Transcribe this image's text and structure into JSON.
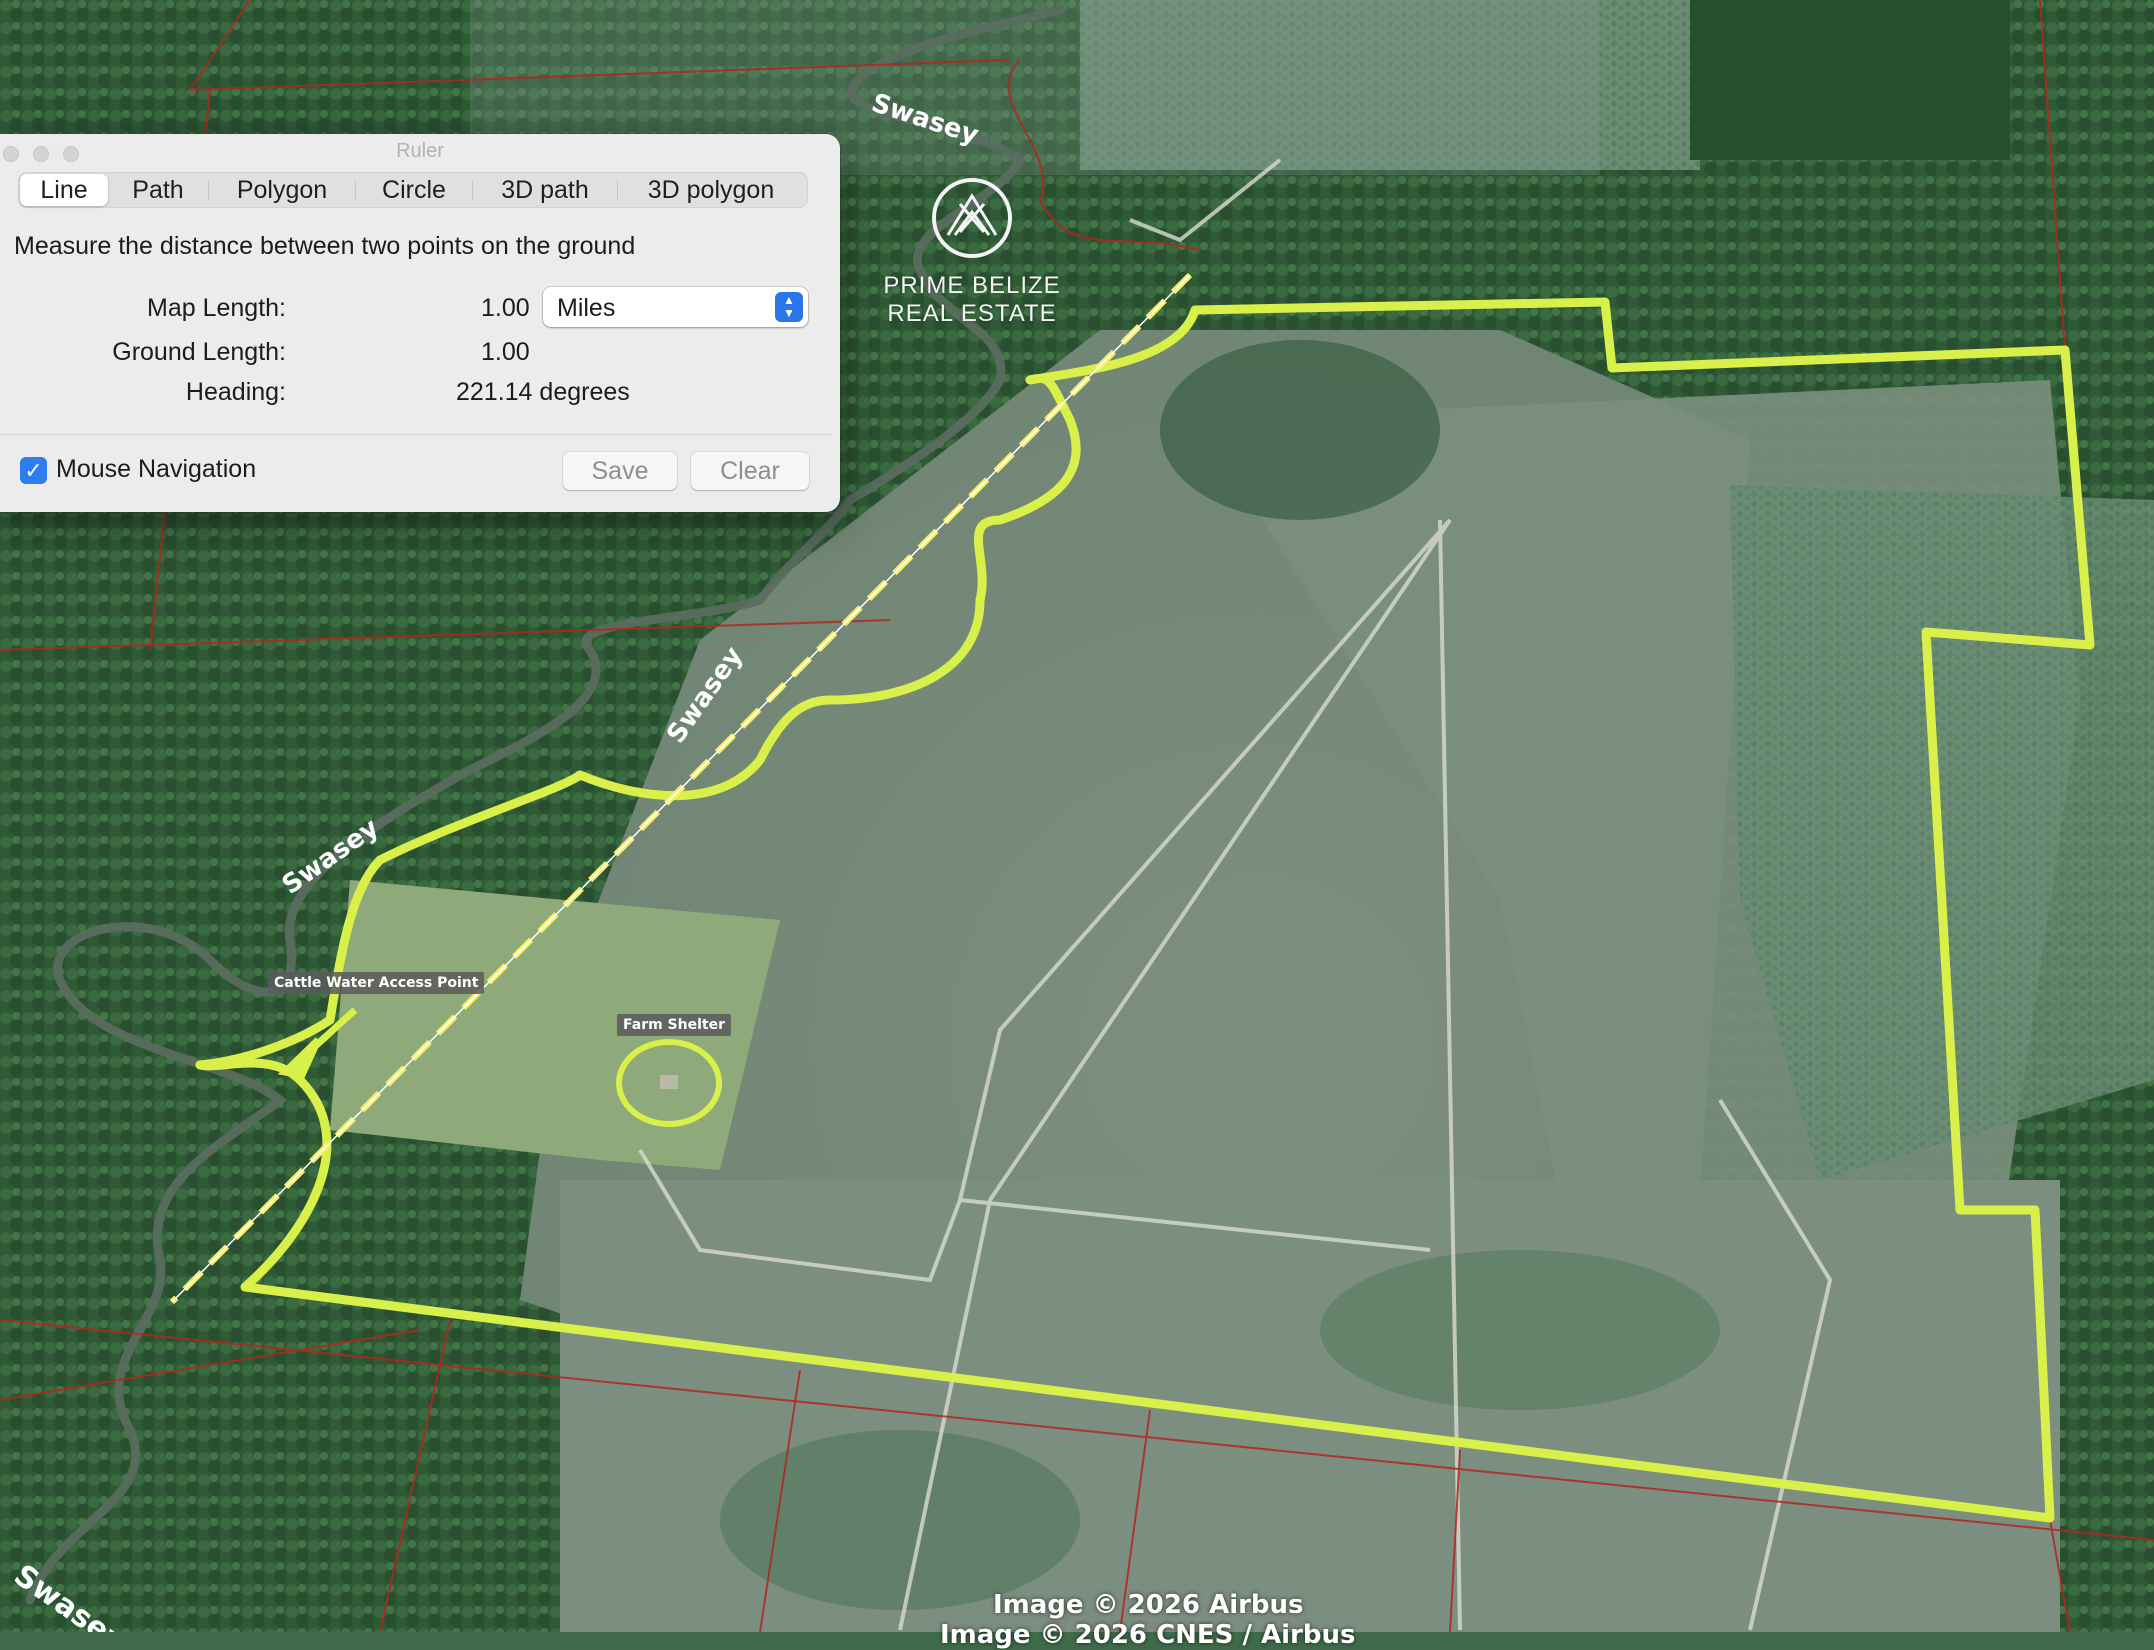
{
  "map": {
    "river_labels": [
      "Swasey",
      "Swasey",
      "Swasey",
      "Swasey"
    ],
    "pin_labels": {
      "cattle_water": "Cattle Water Access Point",
      "farm_shelter": "Farm Shelter"
    },
    "logo_lines": [
      "PRIME BELIZE",
      "REAL ESTATE"
    ],
    "credits": [
      "Image © 2026 Airbus",
      "Image © 2026 CNES / Airbus"
    ],
    "colors": {
      "boundary": "#d9f04a",
      "parcel_lines": "#b3261e",
      "ruler_line": "#f5f06a"
    }
  },
  "ruler": {
    "title": "Ruler",
    "tabs": [
      "Line",
      "Path",
      "Polygon",
      "Circle",
      "3D path",
      "3D polygon"
    ],
    "selected_tab": "Line",
    "description": "Measure the distance between two points on the ground",
    "map_length_label": "Map Length:",
    "map_length_value": "1.00",
    "unit": "Miles",
    "ground_length_label": "Ground Length:",
    "ground_length_value": "1.00",
    "heading_label": "Heading:",
    "heading_value": "221.14 degrees",
    "mouse_nav_label": "Mouse Navigation",
    "mouse_nav_checked": true,
    "save_label": "Save",
    "clear_label": "Clear",
    "icons": {
      "checkbox": "checkmark-icon",
      "unit_stepper": "chevron-updown-icon"
    }
  }
}
